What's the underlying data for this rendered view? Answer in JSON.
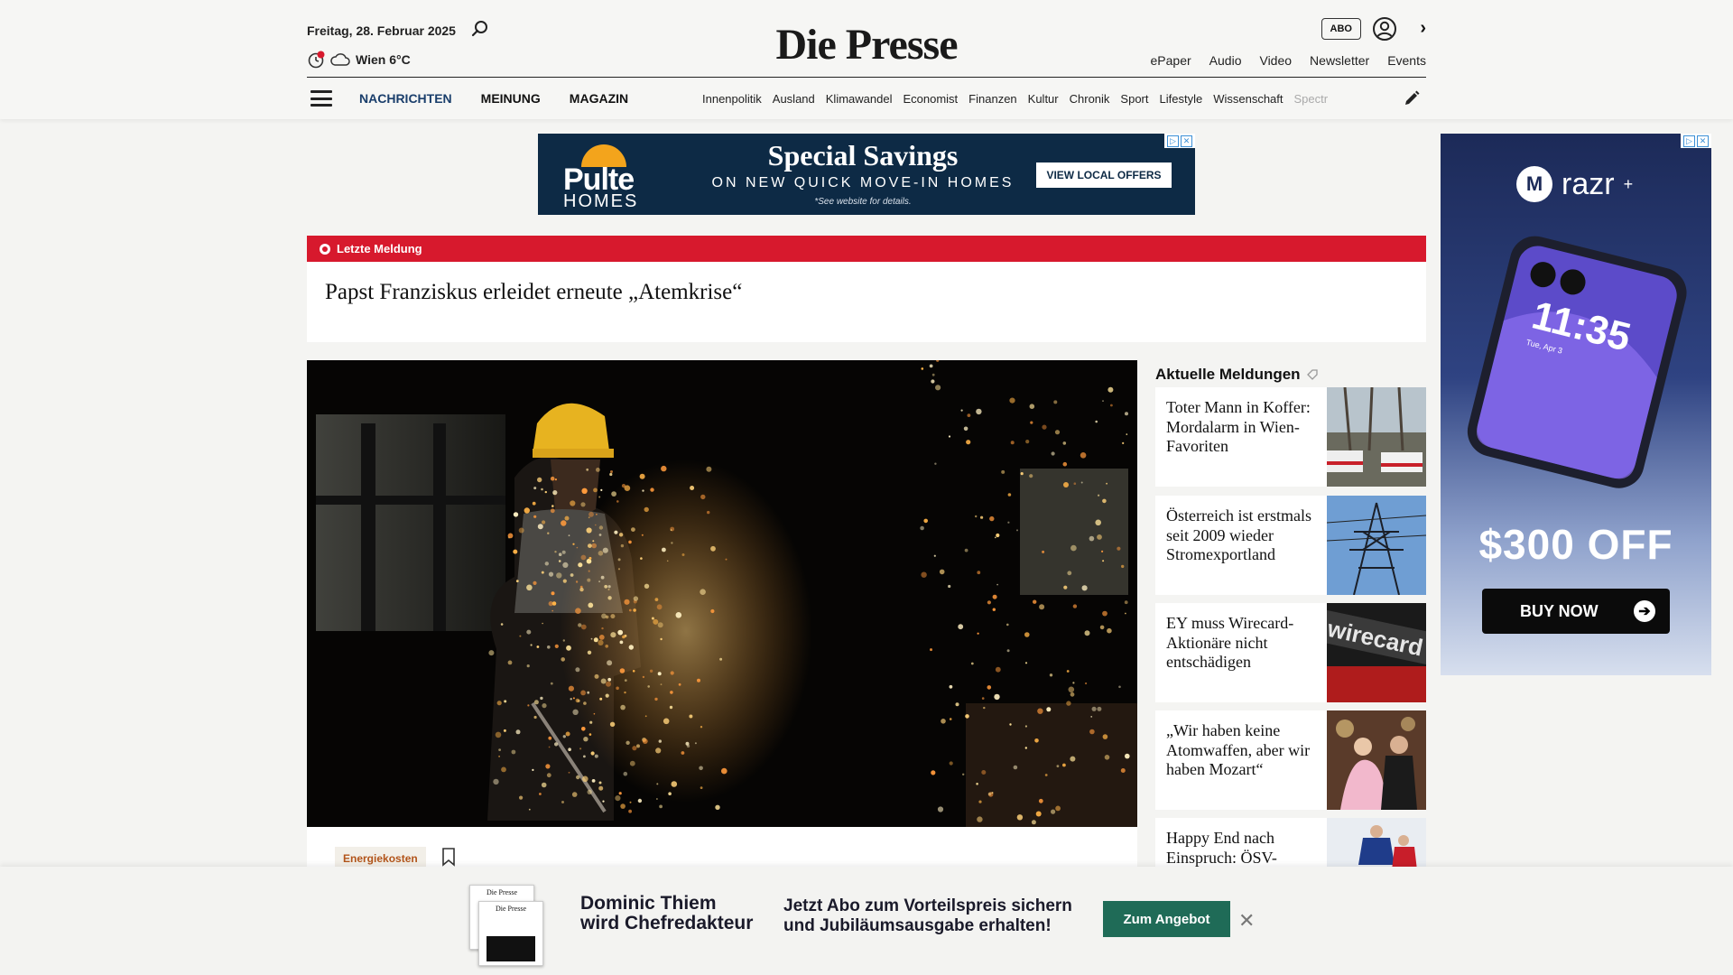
{
  "header": {
    "date": "Freitag, 28. Februar 2025",
    "weather": "Wien 6°C",
    "logo": "Die Presse",
    "abo": "ABO",
    "toplinks": [
      "ePaper",
      "Audio",
      "Video",
      "Newsletter",
      "Events"
    ]
  },
  "nav": {
    "main": [
      "NACHRICHTEN",
      "MEINUNG",
      "MAGAZIN"
    ],
    "sub": [
      "Innenpolitik",
      "Ausland",
      "Klimawandel",
      "Economist",
      "Finanzen",
      "Kultur",
      "Chronik",
      "Sport",
      "Lifestyle",
      "Wissenschaft"
    ],
    "sub_faded": "Spectr"
  },
  "ad_top": {
    "brand_line1": "Pulte",
    "brand_line2": "HOMES",
    "headline": "Special Savings",
    "subline": "ON NEW QUICK MOVE-IN HOMES",
    "note": "*See website for details.",
    "cta": "VIEW LOCAL OFFERS"
  },
  "breaking": {
    "label": "Letzte Meldung",
    "headline": "Papst Franziskus erleidet erneute „Atemkrise“"
  },
  "hero": {
    "tag": "Energiekosten"
  },
  "aktuell": {
    "title": "Aktuelle Meldungen",
    "items": [
      {
        "text": "Toter Mann in Koffer: Mordalarm in Wien-Favoriten"
      },
      {
        "text": "Österreich ist erstmals seit 2009 wieder Stromexportland"
      },
      {
        "text": "EY muss Wirecard-Aktionäre nicht entschädigen"
      },
      {
        "text": "„Wir haben keine Atomwaffen, aber wir haben Mozart“"
      },
      {
        "text": "Happy End nach Einspruch: ÖSV-"
      }
    ]
  },
  "side_ad": {
    "brand": "razr",
    "brand_sup": "+",
    "phone_time": "11:35",
    "phone_date": "Tue, Apr 3",
    "offer": "$300 OFF",
    "cta": "BUY NOW"
  },
  "promo": {
    "title_line1": "Dominic Thiem",
    "title_line2": "wird Chefredakteur",
    "text_line1": "Jetzt Abo zum Vorteilspreis sichern",
    "text_line2": "und Jubiläumsausgabe erhalten!",
    "button": "Zum Angebot",
    "close": "✕",
    "paper_masthead": "Die Presse"
  }
}
